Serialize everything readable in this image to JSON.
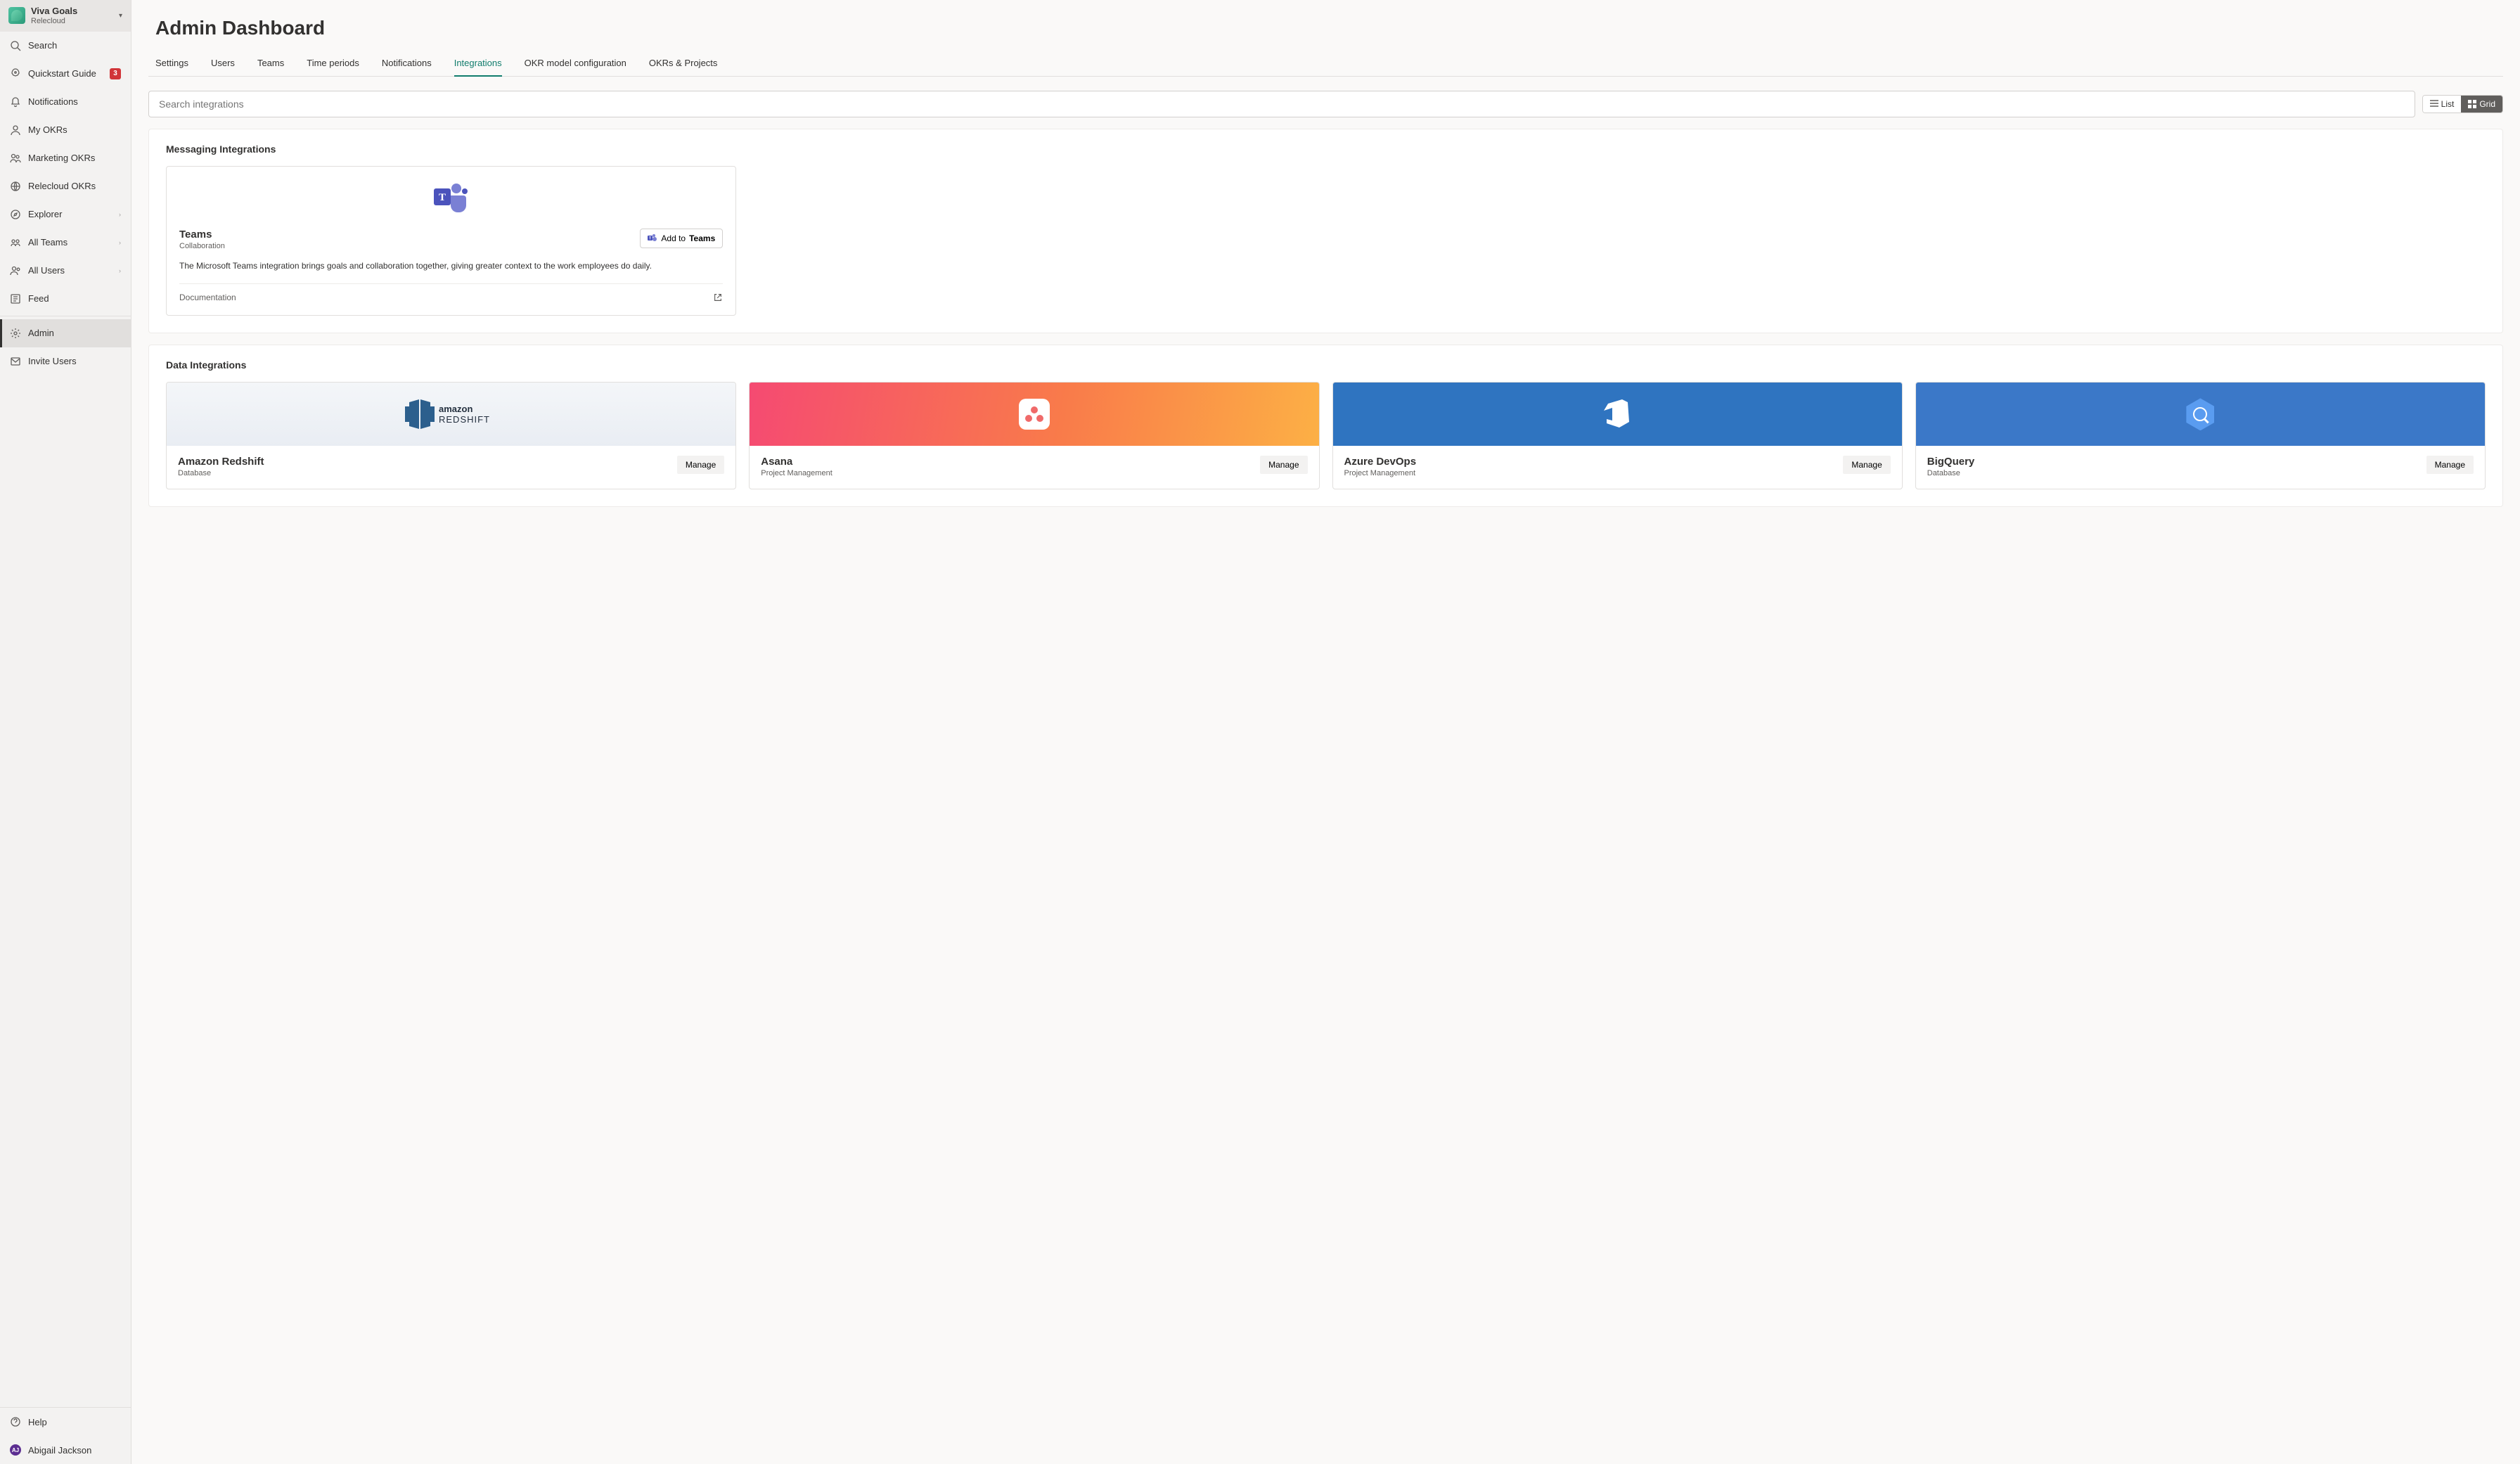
{
  "org": {
    "title": "Viva Goals",
    "subtitle": "Relecloud"
  },
  "sidebar": {
    "items": [
      {
        "label": "Search",
        "icon": "search"
      },
      {
        "label": "Quickstart Guide",
        "icon": "rocket",
        "badge": "3"
      },
      {
        "label": "Notifications",
        "icon": "bell"
      },
      {
        "label": "My OKRs",
        "icon": "person"
      },
      {
        "label": "Marketing OKRs",
        "icon": "people"
      },
      {
        "label": "Relecloud OKRs",
        "icon": "globe"
      },
      {
        "label": "Explorer",
        "icon": "compass",
        "chev": true
      },
      {
        "label": "All Teams",
        "icon": "teams",
        "chev": true
      },
      {
        "label": "All Users",
        "icon": "users",
        "chev": true
      },
      {
        "label": "Feed",
        "icon": "feed"
      }
    ],
    "admin_label": "Admin",
    "invite_label": "Invite Users",
    "help_label": "Help",
    "user": {
      "name": "Abigail Jackson",
      "initials": "AJ"
    }
  },
  "page": {
    "title": "Admin Dashboard",
    "tabs": [
      {
        "label": "Settings"
      },
      {
        "label": "Users"
      },
      {
        "label": "Teams"
      },
      {
        "label": "Time periods"
      },
      {
        "label": "Notifications"
      },
      {
        "label": "Integrations",
        "active": true
      },
      {
        "label": "OKR model configuration"
      },
      {
        "label": "OKRs & Projects"
      }
    ],
    "search_placeholder": "Search integrations",
    "view": {
      "list": "List",
      "grid": "Grid",
      "active": "grid"
    }
  },
  "sections": {
    "messaging": {
      "title": "Messaging Integrations",
      "teams": {
        "name": "Teams",
        "category": "Collaboration",
        "add_prefix": "Add to",
        "add_target": "Teams",
        "description": "The Microsoft Teams integration brings goals and collaboration together, giving greater context to the work employees do daily.",
        "doc_label": "Documentation"
      }
    },
    "data": {
      "title": "Data Integrations",
      "cards": [
        {
          "name": "Amazon Redshift",
          "category": "Database",
          "action": "Manage",
          "banner": "redshift"
        },
        {
          "name": "Asana",
          "category": "Project Management",
          "action": "Manage",
          "banner": "asana"
        },
        {
          "name": "Azure DevOps",
          "category": "Project Management",
          "action": "Manage",
          "banner": "azure"
        },
        {
          "name": "BigQuery",
          "category": "Database",
          "action": "Manage",
          "banner": "bq"
        }
      ]
    }
  }
}
